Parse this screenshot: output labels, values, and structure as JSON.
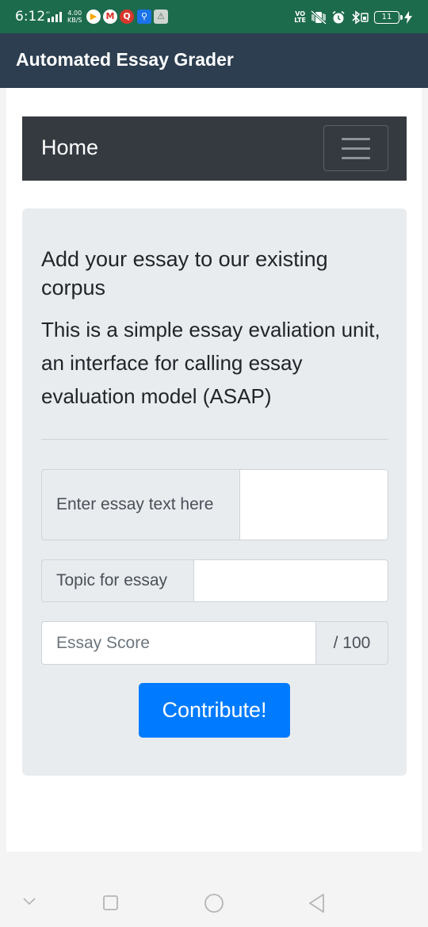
{
  "status_bar": {
    "time": "6:12",
    "net_speed_value": "4.00",
    "net_speed_unit": "KB/S",
    "volte": "VO",
    "volte_sub": "LTE",
    "battery_level": "11",
    "app_icons": [
      "youtube-music-icon",
      "gmail-icon",
      "q-app-icon",
      "usb-icon",
      "android-auto-icon"
    ]
  },
  "app_bar": {
    "title": "Automated Essay Grader"
  },
  "navbar": {
    "brand": "Home"
  },
  "jumbotron": {
    "heading": "Add your essay to our existing corpus",
    "lead": "This is a simple essay evaliation unit, an interface for calling essay evaluation model (ASAP)"
  },
  "form": {
    "essay_text_label": "Enter essay text here",
    "essay_text_value": "",
    "topic_label": "Topic for essay",
    "topic_value": "",
    "score_placeholder": "Essay Score",
    "score_suffix": "/ 100",
    "submit_label": "Contribute!"
  },
  "colors": {
    "status_bar": "#1d6b4d",
    "app_bar": "#2c3e50",
    "navbar": "#343a40",
    "jumbotron": "#e9ecef",
    "primary_button": "#007bff"
  }
}
